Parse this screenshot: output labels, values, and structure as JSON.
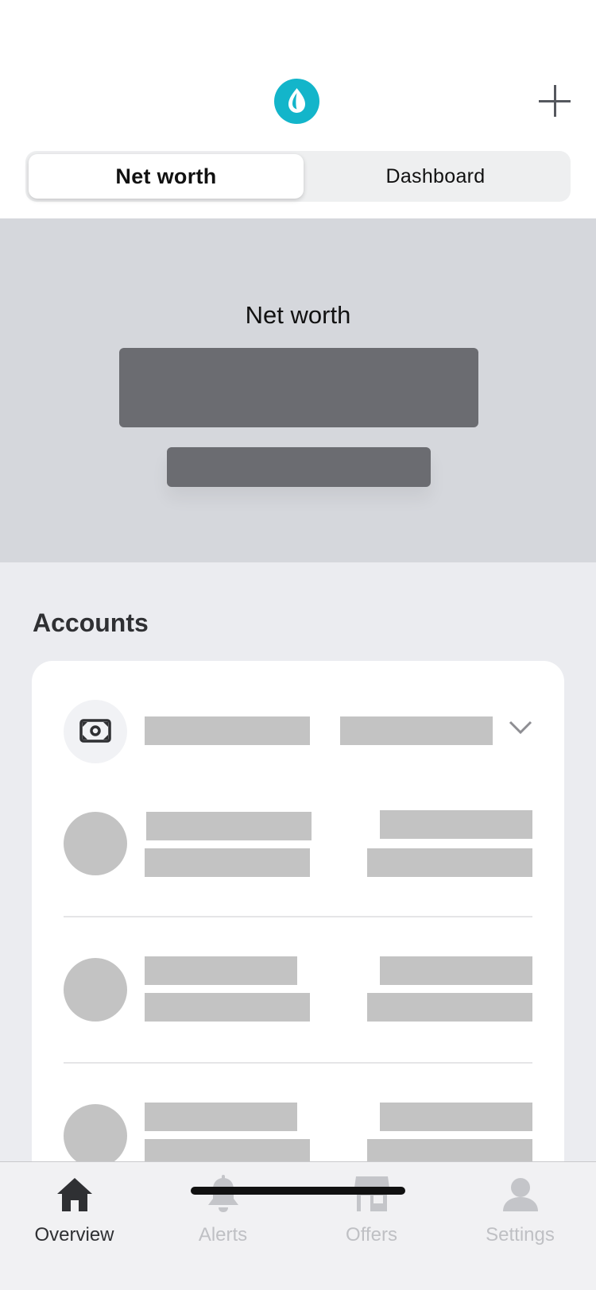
{
  "header": {
    "logo_icon": "mint-leaf-icon",
    "add_icon": "plus-icon",
    "segments": [
      "Net worth",
      "Dashboard"
    ],
    "active_segment": "Net worth"
  },
  "net_worth": {
    "title": "Net worth"
  },
  "accounts": {
    "title": "Accounts",
    "group_icon": "cash-icon",
    "expand_icon": "chevron-down-icon"
  },
  "tabbar": {
    "tabs": [
      {
        "label": "Overview",
        "icon": "home-icon",
        "active": true
      },
      {
        "label": "Alerts",
        "icon": "bell-icon",
        "active": false
      },
      {
        "label": "Offers",
        "icon": "store-icon",
        "active": false
      },
      {
        "label": "Settings",
        "icon": "user-icon",
        "active": false
      }
    ]
  },
  "colors": {
    "accent": "#13b5ca",
    "placeholder_dark": "#6b6c71",
    "placeholder_light": "#c3c3c3",
    "panel": "#d5d7dc",
    "background": "#ebecf0"
  }
}
